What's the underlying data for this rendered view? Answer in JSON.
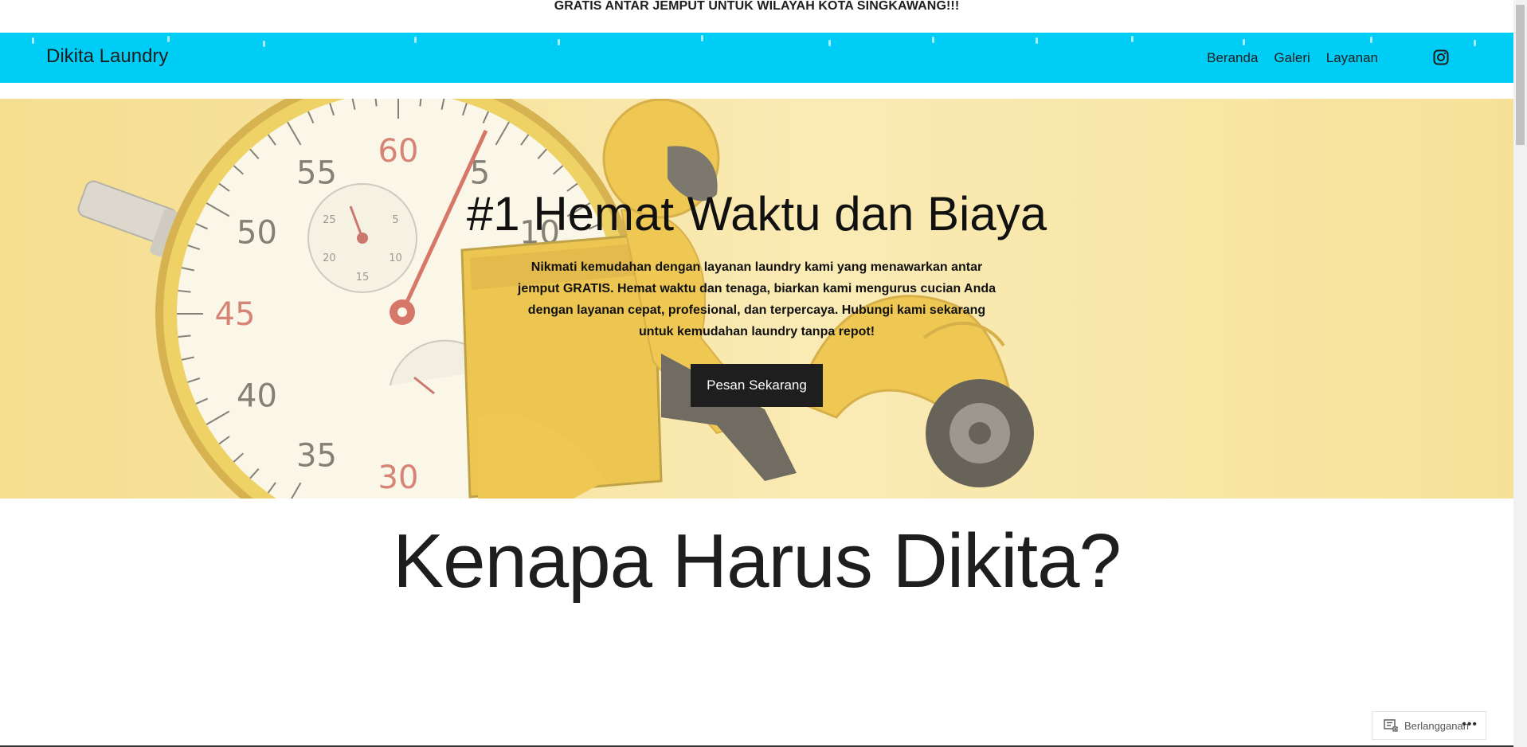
{
  "announcement": "GRATIS ANTAR JEMPUT UNTUK WILAYAH KOTA SINGKAWANG!!!",
  "header": {
    "site_title": "Dikita Laundry",
    "background_color": "#00cdf6",
    "nav": [
      {
        "label": "Beranda"
      },
      {
        "label": "Galeri"
      },
      {
        "label": "Layanan"
      }
    ],
    "social_icon": "instagram-icon"
  },
  "hero": {
    "title": "#1 Hemat Waktu dan Biaya",
    "text": "Nikmati kemudahan dengan layanan laundry kami yang menawarkan antar jemput GRATIS. Hemat waktu dan tenaga, biarkan kami mengurus cucian Anda dengan layanan cepat, profesional, dan terpercaya. Hubungi kami sekarang untuk kemudahan laundry tanpa repot!",
    "button_label": "Pesan Sekarang",
    "background_image": "stopwatch-delivery-scooter-illustration",
    "stopwatch_numbers": [
      "60",
      "5",
      "10",
      "55",
      "50",
      "45",
      "40",
      "35",
      "30"
    ],
    "subdial_numbers": [
      "5",
      "10",
      "15",
      "20",
      "25"
    ]
  },
  "section": {
    "title": "Kenapa Harus Dikita?"
  },
  "subscribe": {
    "label": "Berlangganan",
    "more": "•••"
  }
}
